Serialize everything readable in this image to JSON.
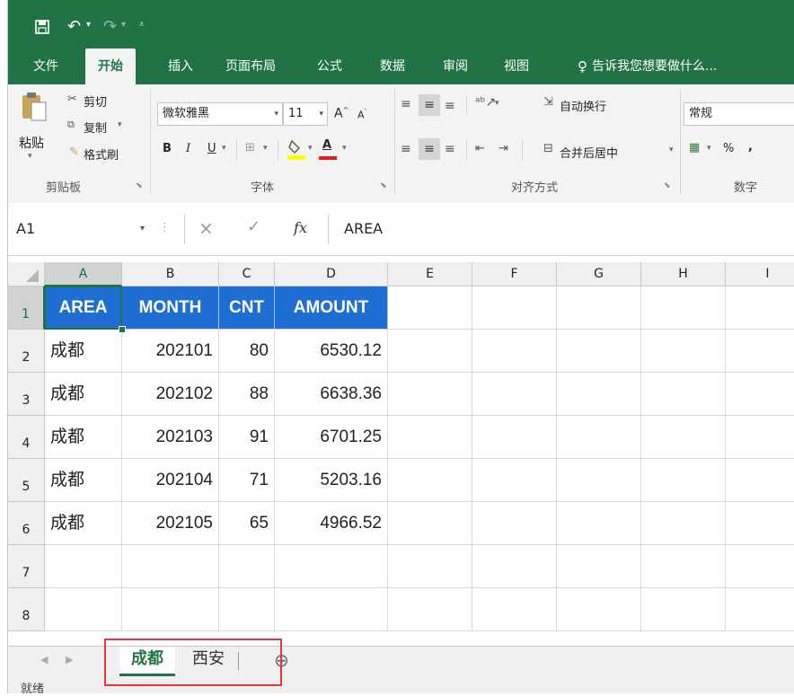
{
  "qat": {
    "icons": [
      "save-icon",
      "undo-icon",
      "redo-icon",
      "customize-icon"
    ]
  },
  "tabs": [
    {
      "label": "文件",
      "active": false
    },
    {
      "label": "开始",
      "active": true
    },
    {
      "label": "插入",
      "active": false
    },
    {
      "label": "页面布局",
      "active": false
    },
    {
      "label": "公式",
      "active": false
    },
    {
      "label": "数据",
      "active": false
    },
    {
      "label": "审阅",
      "active": false
    },
    {
      "label": "视图",
      "active": false
    }
  ],
  "tell_me": "告诉我您想要做什么...",
  "ribbon": {
    "clipboard": {
      "paste": "粘贴",
      "cut": "剪切",
      "copy": "复制",
      "format_painter": "格式刷",
      "group": "剪贴板"
    },
    "font": {
      "name": "微软雅黑",
      "size": "11",
      "bold": "B",
      "italic": "I",
      "underline": "U",
      "font_color": "A",
      "group": "字体"
    },
    "alignment": {
      "wrap": "自动换行",
      "merge": "合并后居中",
      "group": "对齐方式"
    },
    "number": {
      "format": "常规",
      "percent": "%",
      "comma": ",",
      "group": "数字"
    }
  },
  "formula_bar": {
    "name_box": "A1",
    "cancel": "×",
    "enter": "✓",
    "fx": "fx",
    "value": "AREA"
  },
  "columns": [
    "A",
    "B",
    "C",
    "D",
    "E",
    "F",
    "G",
    "H",
    "I"
  ],
  "rows": [
    "1",
    "2",
    "3",
    "4",
    "5",
    "6",
    "7",
    "8"
  ],
  "table": {
    "headers": [
      "AREA",
      "MONTH",
      "CNT",
      "AMOUNT"
    ],
    "data": [
      [
        "成都",
        "202101",
        "80",
        "6530.12"
      ],
      [
        "成都",
        "202102",
        "88",
        "6638.36"
      ],
      [
        "成都",
        "202103",
        "91",
        "6701.25"
      ],
      [
        "成都",
        "202104",
        "71",
        "5203.16"
      ],
      [
        "成都",
        "202105",
        "65",
        "4966.52"
      ]
    ]
  },
  "sheets": [
    {
      "label": "成都",
      "active": true
    },
    {
      "label": "西安",
      "active": false
    }
  ],
  "status": "就绪",
  "colors": {
    "excel_green": "#217346",
    "header_fill": "#1f6ed4",
    "highlight": "#e8343b"
  }
}
